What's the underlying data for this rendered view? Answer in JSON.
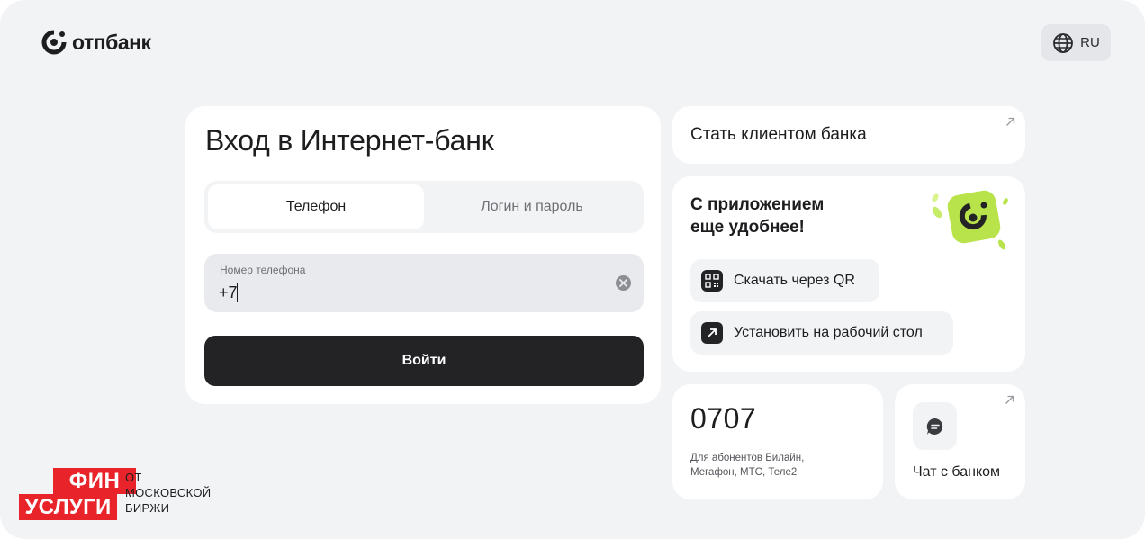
{
  "header": {
    "logo_text": "отпбанк",
    "language": "RU"
  },
  "login": {
    "title": "Вход в Интернет-банк",
    "tabs": [
      {
        "label": "Телефон",
        "active": true
      },
      {
        "label": "Логин и пароль",
        "active": false
      }
    ],
    "phone_label": "Номер телефона",
    "phone_value": "+7",
    "submit_label": "Войти"
  },
  "become_client": {
    "label": "Стать клиентом банка"
  },
  "app_promo": {
    "title_line1": "С приложением",
    "title_line2": "еще удобнее!",
    "qr_label": "Скачать через QR",
    "desktop_label": "Установить на рабочий стол",
    "accent_color": "#b8e34a"
  },
  "hotline": {
    "number": "0707",
    "note_line1": "Для абонентов Билайн,",
    "note_line2": "Мегафон, МТС, Теле2"
  },
  "chat": {
    "label": "Чат с банком"
  },
  "fin_uslugi": {
    "word1": "ФИН",
    "word2": "УСЛУГИ",
    "caption_line1": "ОТ",
    "caption_line2": "МОСКОВСКОЙ",
    "caption_line3": "БИРЖИ",
    "brand_color": "#e8242a"
  }
}
